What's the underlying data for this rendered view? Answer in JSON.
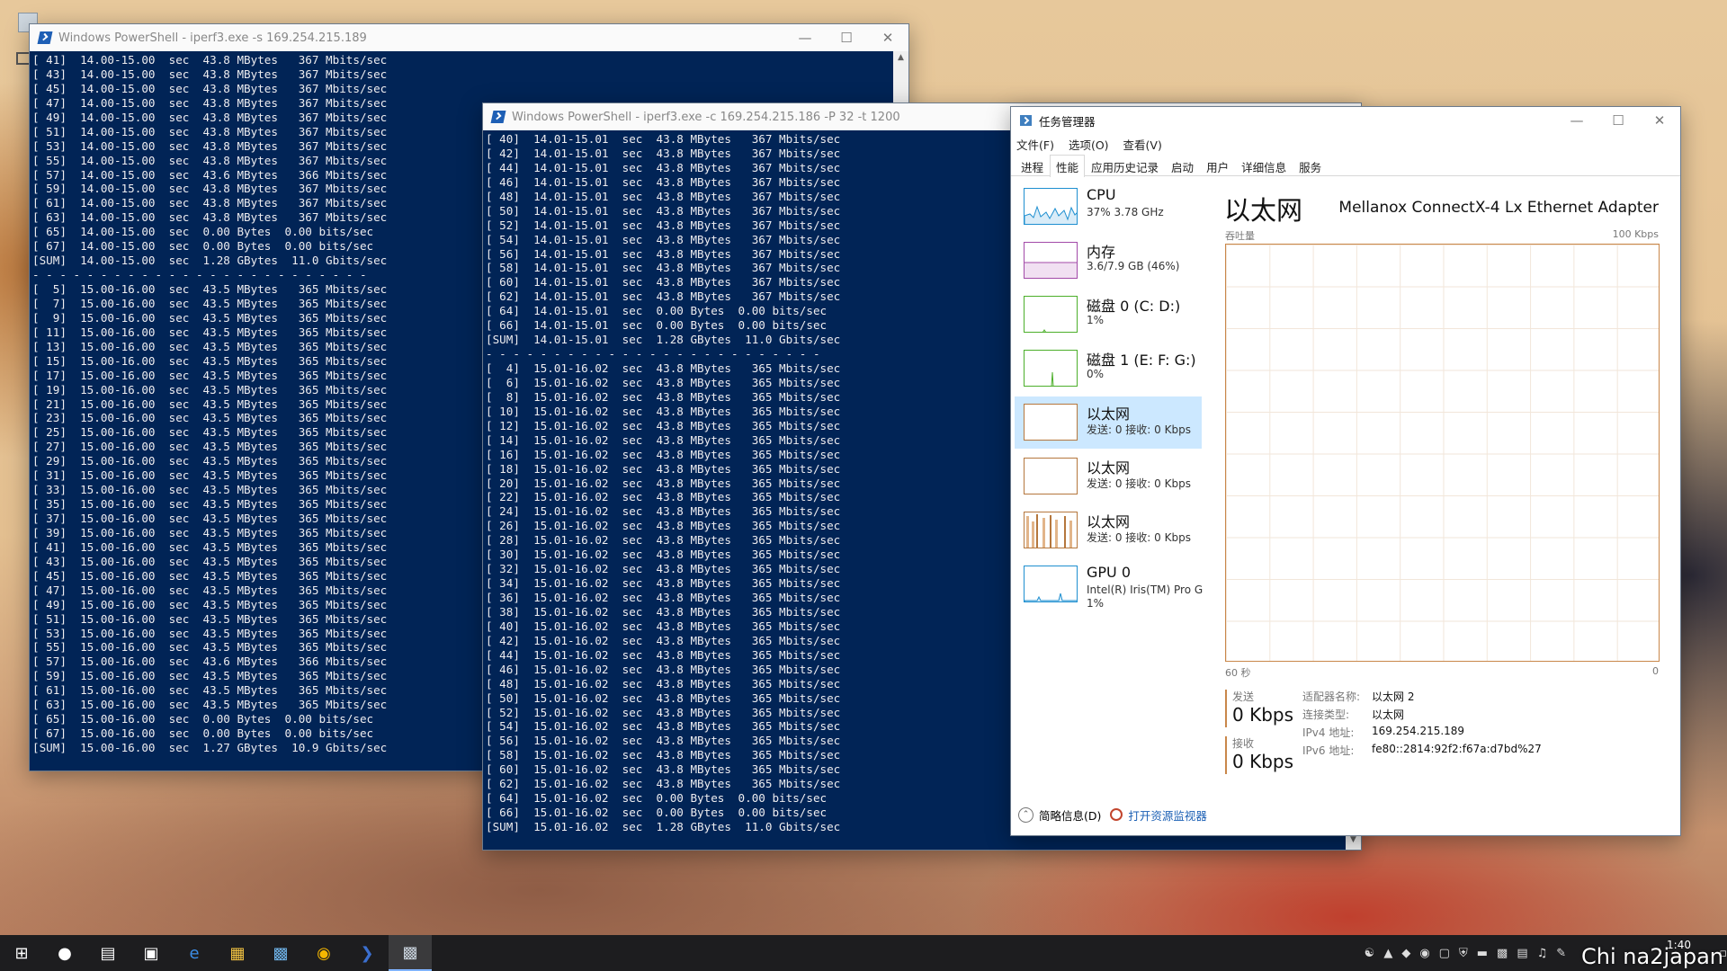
{
  "ps1": {
    "title": "Windows PowerShell - iperf3.exe  -s 169.254.215.189",
    "lines": [
      "[ 41]  14.00-15.00  sec  43.8 MBytes   367 Mbits/sec",
      "[ 43]  14.00-15.00  sec  43.8 MBytes   367 Mbits/sec",
      "[ 45]  14.00-15.00  sec  43.8 MBytes   367 Mbits/sec",
      "[ 47]  14.00-15.00  sec  43.8 MBytes   367 Mbits/sec",
      "[ 49]  14.00-15.00  sec  43.8 MBytes   367 Mbits/sec",
      "[ 51]  14.00-15.00  sec  43.8 MBytes   367 Mbits/sec",
      "[ 53]  14.00-15.00  sec  43.8 MBytes   367 Mbits/sec",
      "[ 55]  14.00-15.00  sec  43.8 MBytes   367 Mbits/sec",
      "[ 57]  14.00-15.00  sec  43.6 MBytes   366 Mbits/sec",
      "[ 59]  14.00-15.00  sec  43.8 MBytes   367 Mbits/sec",
      "[ 61]  14.00-15.00  sec  43.8 MBytes   367 Mbits/sec",
      "[ 63]  14.00-15.00  sec  43.8 MBytes   367 Mbits/sec",
      "[ 65]  14.00-15.00  sec  0.00 Bytes  0.00 bits/sec",
      "[ 67]  14.00-15.00  sec  0.00 Bytes  0.00 bits/sec",
      "[SUM]  14.00-15.00  sec  1.28 GBytes  11.0 Gbits/sec",
      "- - - - - - - - - - - - - - - - - - - - - - - - -",
      "[  5]  15.00-16.00  sec  43.5 MBytes   365 Mbits/sec",
      "[  7]  15.00-16.00  sec  43.5 MBytes   365 Mbits/sec",
      "[  9]  15.00-16.00  sec  43.5 MBytes   365 Mbits/sec",
      "[ 11]  15.00-16.00  sec  43.5 MBytes   365 Mbits/sec",
      "[ 13]  15.00-16.00  sec  43.5 MBytes   365 Mbits/sec",
      "[ 15]  15.00-16.00  sec  43.5 MBytes   365 Mbits/sec",
      "[ 17]  15.00-16.00  sec  43.5 MBytes   365 Mbits/sec",
      "[ 19]  15.00-16.00  sec  43.5 MBytes   365 Mbits/sec",
      "[ 21]  15.00-16.00  sec  43.5 MBytes   365 Mbits/sec",
      "[ 23]  15.00-16.00  sec  43.5 MBytes   365 Mbits/sec",
      "[ 25]  15.00-16.00  sec  43.5 MBytes   365 Mbits/sec",
      "[ 27]  15.00-16.00  sec  43.5 MBytes   365 Mbits/sec",
      "[ 29]  15.00-16.00  sec  43.5 MBytes   365 Mbits/sec",
      "[ 31]  15.00-16.00  sec  43.5 MBytes   365 Mbits/sec",
      "[ 33]  15.00-16.00  sec  43.5 MBytes   365 Mbits/sec",
      "[ 35]  15.00-16.00  sec  43.5 MBytes   365 Mbits/sec",
      "[ 37]  15.00-16.00  sec  43.5 MBytes   365 Mbits/sec",
      "[ 39]  15.00-16.00  sec  43.5 MBytes   365 Mbits/sec",
      "[ 41]  15.00-16.00  sec  43.5 MBytes   365 Mbits/sec",
      "[ 43]  15.00-16.00  sec  43.5 MBytes   365 Mbits/sec",
      "[ 45]  15.00-16.00  sec  43.5 MBytes   365 Mbits/sec",
      "[ 47]  15.00-16.00  sec  43.5 MBytes   365 Mbits/sec",
      "[ 49]  15.00-16.00  sec  43.5 MBytes   365 Mbits/sec",
      "[ 51]  15.00-16.00  sec  43.5 MBytes   365 Mbits/sec",
      "[ 53]  15.00-16.00  sec  43.5 MBytes   365 Mbits/sec",
      "[ 55]  15.00-16.00  sec  43.5 MBytes   365 Mbits/sec",
      "[ 57]  15.00-16.00  sec  43.6 MBytes   366 Mbits/sec",
      "[ 59]  15.00-16.00  sec  43.5 MBytes   365 Mbits/sec",
      "[ 61]  15.00-16.00  sec  43.5 MBytes   365 Mbits/sec",
      "[ 63]  15.00-16.00  sec  43.5 MBytes   365 Mbits/sec",
      "[ 65]  15.00-16.00  sec  0.00 Bytes  0.00 bits/sec",
      "[ 67]  15.00-16.00  sec  0.00 Bytes  0.00 bits/sec",
      "[SUM]  15.00-16.00  sec  1.27 GBytes  10.9 Gbits/sec"
    ]
  },
  "ps2": {
    "title": "Windows PowerShell - iperf3.exe  -c 169.254.215.186 -P 32 -t 1200",
    "lines": [
      "[ 40]  14.01-15.01  sec  43.8 MBytes   367 Mbits/sec",
      "[ 42]  14.01-15.01  sec  43.8 MBytes   367 Mbits/sec",
      "[ 44]  14.01-15.01  sec  43.8 MBytes   367 Mbits/sec",
      "[ 46]  14.01-15.01  sec  43.8 MBytes   367 Mbits/sec",
      "[ 48]  14.01-15.01  sec  43.8 MBytes   367 Mbits/sec",
      "[ 50]  14.01-15.01  sec  43.8 MBytes   367 Mbits/sec",
      "[ 52]  14.01-15.01  sec  43.8 MBytes   367 Mbits/sec",
      "[ 54]  14.01-15.01  sec  43.8 MBytes   367 Mbits/sec",
      "[ 56]  14.01-15.01  sec  43.8 MBytes   367 Mbits/sec",
      "[ 58]  14.01-15.01  sec  43.8 MBytes   367 Mbits/sec",
      "[ 60]  14.01-15.01  sec  43.8 MBytes   367 Mbits/sec",
      "[ 62]  14.01-15.01  sec  43.8 MBytes   367 Mbits/sec",
      "[ 64]  14.01-15.01  sec  0.00 Bytes  0.00 bits/sec",
      "[ 66]  14.01-15.01  sec  0.00 Bytes  0.00 bits/sec",
      "[SUM]  14.01-15.01  sec  1.28 GBytes  11.0 Gbits/sec",
      "- - - - - - - - - - - - - - - - - - - - - - - - -",
      "[  4]  15.01-16.02  sec  43.8 MBytes   365 Mbits/sec",
      "[  6]  15.01-16.02  sec  43.8 MBytes   365 Mbits/sec",
      "[  8]  15.01-16.02  sec  43.8 MBytes   365 Mbits/sec",
      "[ 10]  15.01-16.02  sec  43.8 MBytes   365 Mbits/sec",
      "[ 12]  15.01-16.02  sec  43.8 MBytes   365 Mbits/sec",
      "[ 14]  15.01-16.02  sec  43.8 MBytes   365 Mbits/sec",
      "[ 16]  15.01-16.02  sec  43.8 MBytes   365 Mbits/sec",
      "[ 18]  15.01-16.02  sec  43.8 MBytes   365 Mbits/sec",
      "[ 20]  15.01-16.02  sec  43.8 MBytes   365 Mbits/sec",
      "[ 22]  15.01-16.02  sec  43.8 MBytes   365 Mbits/sec",
      "[ 24]  15.01-16.02  sec  43.8 MBytes   365 Mbits/sec",
      "[ 26]  15.01-16.02  sec  43.8 MBytes   365 Mbits/sec",
      "[ 28]  15.01-16.02  sec  43.8 MBytes   365 Mbits/sec",
      "[ 30]  15.01-16.02  sec  43.8 MBytes   365 Mbits/sec",
      "[ 32]  15.01-16.02  sec  43.8 MBytes   365 Mbits/sec",
      "[ 34]  15.01-16.02  sec  43.8 MBytes   365 Mbits/sec",
      "[ 36]  15.01-16.02  sec  43.8 MBytes   365 Mbits/sec",
      "[ 38]  15.01-16.02  sec  43.8 MBytes   365 Mbits/sec",
      "[ 40]  15.01-16.02  sec  43.8 MBytes   365 Mbits/sec",
      "[ 42]  15.01-16.02  sec  43.8 MBytes   365 Mbits/sec",
      "[ 44]  15.01-16.02  sec  43.8 MBytes   365 Mbits/sec",
      "[ 46]  15.01-16.02  sec  43.8 MBytes   365 Mbits/sec",
      "[ 48]  15.01-16.02  sec  43.8 MBytes   365 Mbits/sec",
      "[ 50]  15.01-16.02  sec  43.8 MBytes   365 Mbits/sec",
      "[ 52]  15.01-16.02  sec  43.8 MBytes   365 Mbits/sec",
      "[ 54]  15.01-16.02  sec  43.8 MBytes   365 Mbits/sec",
      "[ 56]  15.01-16.02  sec  43.8 MBytes   365 Mbits/sec",
      "[ 58]  15.01-16.02  sec  43.8 MBytes   365 Mbits/sec",
      "[ 60]  15.01-16.02  sec  43.8 MBytes   365 Mbits/sec",
      "[ 62]  15.01-16.02  sec  43.8 MBytes   365 Mbits/sec",
      "[ 64]  15.01-16.02  sec  0.00 Bytes  0.00 bits/sec",
      "[ 66]  15.01-16.02  sec  0.00 Bytes  0.00 bits/sec",
      "[SUM]  15.01-16.02  sec  1.28 GBytes  11.0 Gbits/sec"
    ]
  },
  "taskmgr": {
    "title": "任务管理器",
    "menu": [
      "文件(F)",
      "选项(O)",
      "查看(V)"
    ],
    "tabs": [
      "进程",
      "性能",
      "应用历史记录",
      "启动",
      "用户",
      "详细信息",
      "服务"
    ],
    "active_tab": "性能",
    "sidebar": [
      {
        "name": "CPU",
        "sub": "37% 3.78 GHz",
        "color": "#1e8fd0"
      },
      {
        "name": "内存",
        "sub": "3.6/7.9 GB (46%)",
        "color": "#a24aa8"
      },
      {
        "name": "磁盘 0 (C: D:)",
        "sub": "1%",
        "color": "#4caf2a"
      },
      {
        "name": "磁盘 1 (E: F: G:)",
        "sub": "0%",
        "color": "#4caf2a"
      },
      {
        "name": "以太网",
        "sub": "发送: 0 接收: 0 Kbps",
        "color": "#b5773d"
      },
      {
        "name": "以太网",
        "sub": "发送: 0 接收: 0 Kbps",
        "color": "#b5773d"
      },
      {
        "name": "以太网",
        "sub": "发送: 0 接收: 0 Kbps",
        "color": "#b5773d"
      },
      {
        "name": "GPU 0",
        "sub": "Intel(R) Iris(TM) Pro G",
        "sub2": "1%",
        "color": "#1e8fd0"
      }
    ],
    "selected_index": 4,
    "main": {
      "title": "以太网",
      "adapter": "Mellanox ConnectX-4 Lx Ethernet Adapter",
      "graph_label": "吞吐量",
      "graph_max": "100 Kbps",
      "graph_left": "60 秒",
      "graph_right": "0",
      "send_label": "发送",
      "send_value": "0 Kbps",
      "recv_label": "接收",
      "recv_value": "0 Kbps",
      "details": [
        {
          "k": "适配器名称:",
          "v": "以太网 2"
        },
        {
          "k": "连接类型:",
          "v": "以太网"
        },
        {
          "k": "IPv4 地址:",
          "v": "169.254.215.189"
        },
        {
          "k": "IPv6 地址:",
          "v": "fe80::2814:92f2:f67a:d7bd%27"
        }
      ]
    },
    "footer": {
      "summary": "简略信息(D)",
      "resmon": "打开资源监视器"
    }
  },
  "taskbar": {
    "time": "1:40",
    "watermark": "Chi na2japan"
  },
  "colors": {
    "console_bg": "#012456",
    "console_fg": "#eeedf0",
    "ethernet": "#c9874a"
  }
}
